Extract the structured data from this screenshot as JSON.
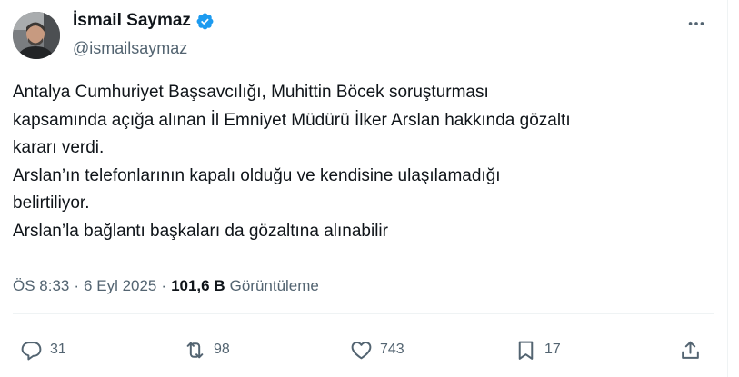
{
  "author": {
    "display_name": "İsmail Saymaz",
    "handle": "@ismailsaymaz",
    "verified": true,
    "verified_color": "#1d9bf0",
    "avatar_icon": "avatar"
  },
  "tweet": {
    "lines": [
      "Antalya Cumhuriyet Başsavcılığı, Muhittin Böcek soruşturması",
      "kapsamında açığa alınan İl Emniyet Müdürü İlker Arslan hakkında gözaltı",
      "kararı verdi.",
      "Arslan’ın telefonlarının kapalı olduğu ve kendisine ulaşılamadığı",
      "belirtiliyor.",
      "Arslan’la bağlantı başkaları da gözaltına alınabilir"
    ]
  },
  "meta": {
    "time": "ÖS 8:33",
    "sep1": "·",
    "date": "6 Eyl 2025",
    "sep2": "·",
    "views": "101,6 B",
    "views_label": "Görüntüleme"
  },
  "actions": {
    "replies": "31",
    "reposts": "98",
    "likes": "743",
    "bookmarks": "17"
  },
  "colors": {
    "text": "#0f1419",
    "secondary": "#536471",
    "accent": "#1d9bf0"
  }
}
